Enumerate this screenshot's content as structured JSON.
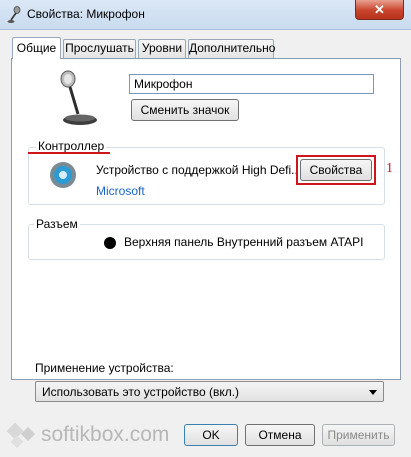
{
  "window": {
    "title": "Свойства: Микрофон",
    "close_label": "✕"
  },
  "tabs": [
    {
      "label": "Общие",
      "active": true
    },
    {
      "label": "Прослушать",
      "active": false
    },
    {
      "label": "Уровни",
      "active": false
    },
    {
      "label": "Дополнительно",
      "active": false
    }
  ],
  "general": {
    "device_name": "Микрофон",
    "change_icon_label": "Сменить значок"
  },
  "controller": {
    "legend": "Контроллер",
    "device_text": "Устройство с поддержкой High Defi...",
    "manufacturer": "Microsoft",
    "properties_label": "Свойства",
    "marker": "1"
  },
  "jack": {
    "legend": "Разъем",
    "description": "Верхняя панель Внутренний разъем ATAPI"
  },
  "usage": {
    "label": "Применение устройства:",
    "selected": "Использовать это устройство (вкл.)"
  },
  "footer": {
    "ok": "OK",
    "cancel": "Отмена",
    "apply": "Применить"
  },
  "watermark": {
    "text": "softikbox.com"
  },
  "colors": {
    "accent_red": "#d0141b",
    "link_blue": "#1a64c8"
  }
}
